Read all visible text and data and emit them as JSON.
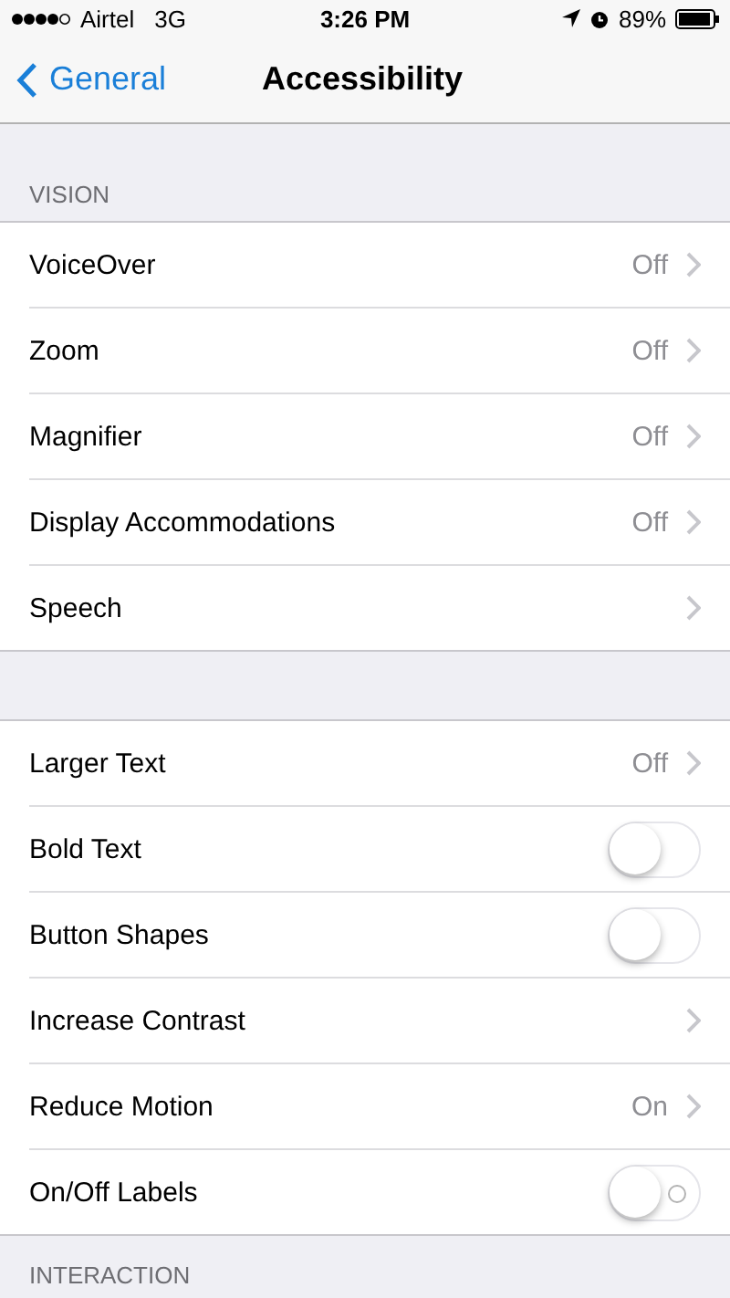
{
  "status_bar": {
    "carrier": "Airtel",
    "network": "3G",
    "time": "3:26 PM",
    "battery": "89%"
  },
  "nav": {
    "back": "General",
    "title": "Accessibility"
  },
  "sections": [
    {
      "header": "VISION",
      "rows": [
        {
          "kind": "link",
          "label": "VoiceOver",
          "value": "Off"
        },
        {
          "kind": "link",
          "label": "Zoom",
          "value": "Off"
        },
        {
          "kind": "link",
          "label": "Magnifier",
          "value": "Off"
        },
        {
          "kind": "link",
          "label": "Display Accommodations",
          "value": "Off"
        },
        {
          "kind": "link",
          "label": "Speech"
        }
      ]
    },
    {
      "rows": [
        {
          "kind": "link",
          "label": "Larger Text",
          "value": "Off"
        },
        {
          "kind": "toggle",
          "label": "Bold Text",
          "on": false
        },
        {
          "kind": "toggle",
          "label": "Button Shapes",
          "on": false
        },
        {
          "kind": "link",
          "label": "Increase Contrast"
        },
        {
          "kind": "link",
          "label": "Reduce Motion",
          "value": "On"
        },
        {
          "kind": "toggle",
          "label": "On/Off Labels",
          "on": false,
          "labels": true
        }
      ]
    },
    {
      "header": "INTERACTION"
    }
  ]
}
